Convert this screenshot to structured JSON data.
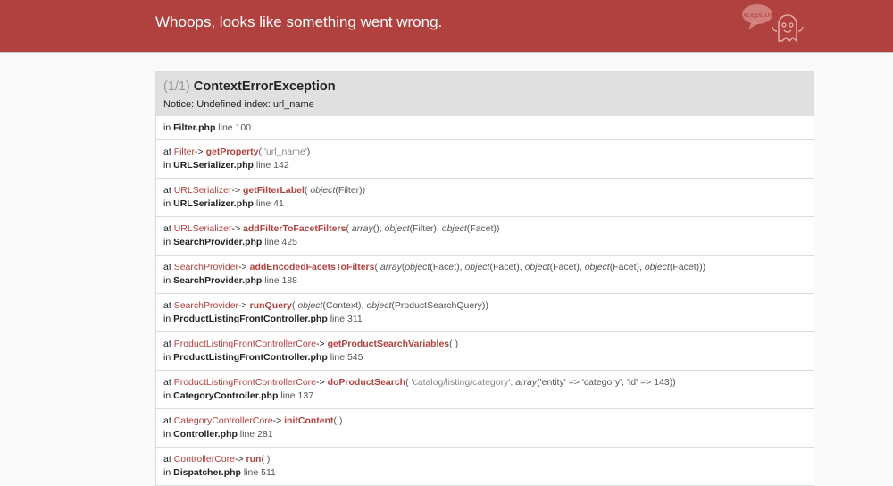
{
  "header": {
    "title": "Whoops, looks like something went wrong.",
    "logo_text": "Exception!"
  },
  "exception": {
    "count": "(1/1)",
    "name": "ContextErrorException",
    "message": "Notice: Undefined index: url_name",
    "file": "Filter.php",
    "line": "line 100"
  },
  "labels": {
    "at": "at",
    "in": "in",
    "arrow": "->"
  },
  "frames": [
    {
      "class": "Filter",
      "method": "getProperty",
      "args": [
        {
          "t": "str",
          "v": "'url_name'"
        }
      ],
      "file": "URLSerializer.php",
      "line": "line 142"
    },
    {
      "class": "URLSerializer",
      "method": "getFilterLabel",
      "args": [
        {
          "t": "typ",
          "v": "object"
        },
        {
          "t": "pl",
          "v": "(Filter)"
        }
      ],
      "file": "URLSerializer.php",
      "line": "line 41"
    },
    {
      "class": "URLSerializer",
      "method": "addFilterToFacetFilters",
      "args": [
        {
          "t": "typ",
          "v": "array"
        },
        {
          "t": "pl",
          "v": "(), "
        },
        {
          "t": "typ",
          "v": "object"
        },
        {
          "t": "pl",
          "v": "(Filter), "
        },
        {
          "t": "typ",
          "v": "object"
        },
        {
          "t": "pl",
          "v": "(Facet)"
        }
      ],
      "file": "SearchProvider.php",
      "line": "line 425"
    },
    {
      "class": "SearchProvider",
      "method": "addEncodedFacetsToFilters",
      "args": [
        {
          "t": "typ",
          "v": "array"
        },
        {
          "t": "pl",
          "v": "("
        },
        {
          "t": "typ",
          "v": "object"
        },
        {
          "t": "pl",
          "v": "(Facet), "
        },
        {
          "t": "typ",
          "v": "object"
        },
        {
          "t": "pl",
          "v": "(Facet), "
        },
        {
          "t": "typ",
          "v": "object"
        },
        {
          "t": "pl",
          "v": "(Facet), "
        },
        {
          "t": "typ",
          "v": "object"
        },
        {
          "t": "pl",
          "v": "(Facet), "
        },
        {
          "t": "typ",
          "v": "object"
        },
        {
          "t": "pl",
          "v": "(Facet))"
        }
      ],
      "file": "SearchProvider.php",
      "line": "line 188"
    },
    {
      "class": "SearchProvider",
      "method": "runQuery",
      "args": [
        {
          "t": "typ",
          "v": "object"
        },
        {
          "t": "pl",
          "v": "(Context), "
        },
        {
          "t": "typ",
          "v": "object"
        },
        {
          "t": "pl",
          "v": "(ProductSearchQuery)"
        }
      ],
      "file": "ProductListingFrontController.php",
      "line": "line 311"
    },
    {
      "class": "ProductListingFrontControllerCore",
      "method": "getProductSearchVariables",
      "args": [],
      "file": "ProductListingFrontController.php",
      "line": "line 545"
    },
    {
      "class": "ProductListingFrontControllerCore",
      "method": "doProductSearch",
      "args": [
        {
          "t": "str",
          "v": "'catalog/listing/category', "
        },
        {
          "t": "typ",
          "v": "array"
        },
        {
          "t": "pl",
          "v": "('entity' => 'category', 'id' => 143)"
        }
      ],
      "file": "CategoryController.php",
      "line": "line 137"
    },
    {
      "class": "CategoryControllerCore",
      "method": "initContent",
      "args": [],
      "file": "Controller.php",
      "line": "line 281"
    },
    {
      "class": "ControllerCore",
      "method": "run",
      "args": [],
      "file": "Dispatcher.php",
      "line": "line 511"
    }
  ]
}
